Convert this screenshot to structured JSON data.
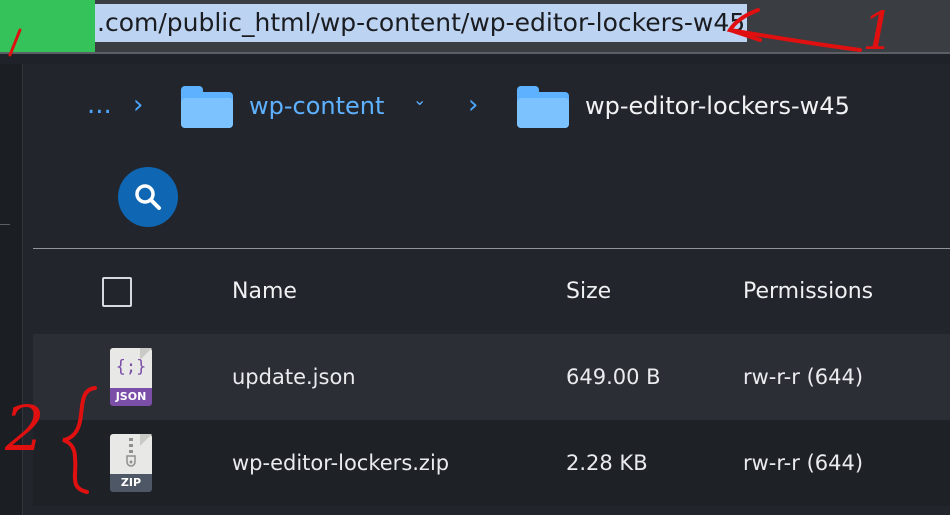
{
  "address_bar": {
    "url": ".com/public_html/wp-content/wp-editor-lockers-w45",
    "annotation_number": "1"
  },
  "breadcrumb": {
    "ellipsis": "...",
    "parent": "wp-content",
    "current": "wp-editor-lockers-w45"
  },
  "icons": {
    "search": "search-icon",
    "folder": "folder-icon",
    "chevron": "chevron-right-icon",
    "caret": "chevron-down-icon"
  },
  "table": {
    "columns": [
      "Name",
      "Size",
      "Permissions"
    ],
    "rows": [
      {
        "name": "update.json",
        "size": "649.00 B",
        "permissions": "rw-r-r (644)",
        "type_label": "JSON"
      },
      {
        "name": "wp-editor-lockers.zip",
        "size": "2.28 KB",
        "permissions": "rw-r-r (644)",
        "type_label": "ZIP"
      }
    ]
  },
  "annotations": {
    "row_marker_number": "2"
  },
  "colors": {
    "accent": "#5eb1ff",
    "search_button": "#0f66b3",
    "annotation": "#e01010",
    "highlight": "#bcd3f2"
  }
}
